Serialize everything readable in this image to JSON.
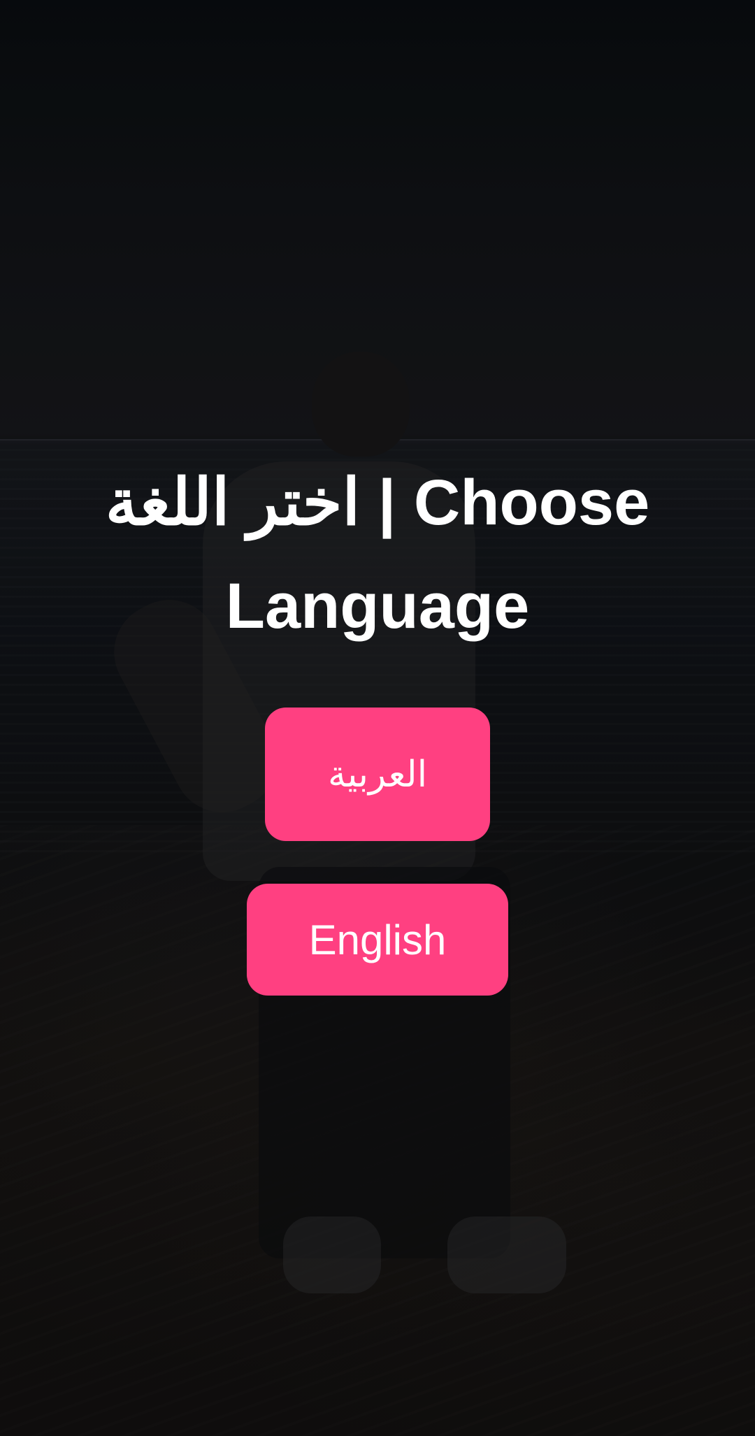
{
  "screen": {
    "title": "اختر اللغة | Choose Language"
  },
  "buttons": {
    "arabic_label": "العربية",
    "english_label": "English"
  },
  "colors": {
    "accent": "#ff4081",
    "text": "#ffffff",
    "overlay": "#000000"
  }
}
